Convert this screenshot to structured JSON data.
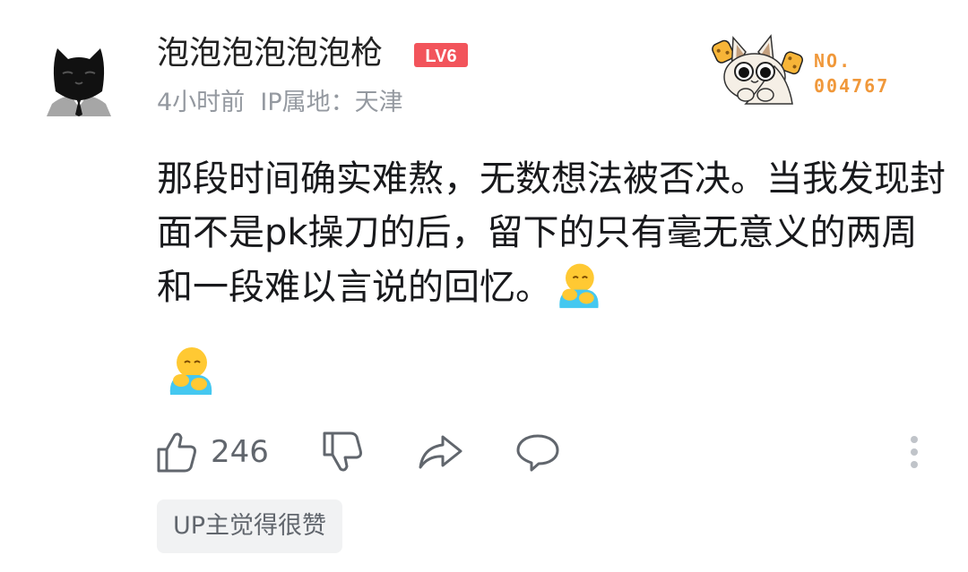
{
  "comment": {
    "username": "泡泡泡泡泡泡枪",
    "level_badge": "LV6",
    "time": "4小时前",
    "ip_location": "IP属地：天津",
    "fan_badge": {
      "label": "NO.",
      "number": "004767"
    },
    "text": "那段时间确实难熬，无数想法被否决。当我发现封面不是pk操刀的后，留下的只有毫无意义的两周和一段难以言说的回忆。",
    "emojis": [
      "hug-emoji",
      "hug-emoji"
    ]
  },
  "actions": {
    "like_count": "246",
    "icons": [
      "thumbs-up-icon",
      "thumbs-down-icon",
      "share-icon",
      "reply-icon",
      "more-icon"
    ]
  },
  "tag": "UP主觉得很赞",
  "colors": {
    "level_red": "#f2545b",
    "fan_orange": "#f0983a",
    "meta_gray": "#9499a0",
    "icon_gray": "#61666d",
    "tag_bg": "#f1f2f3"
  }
}
